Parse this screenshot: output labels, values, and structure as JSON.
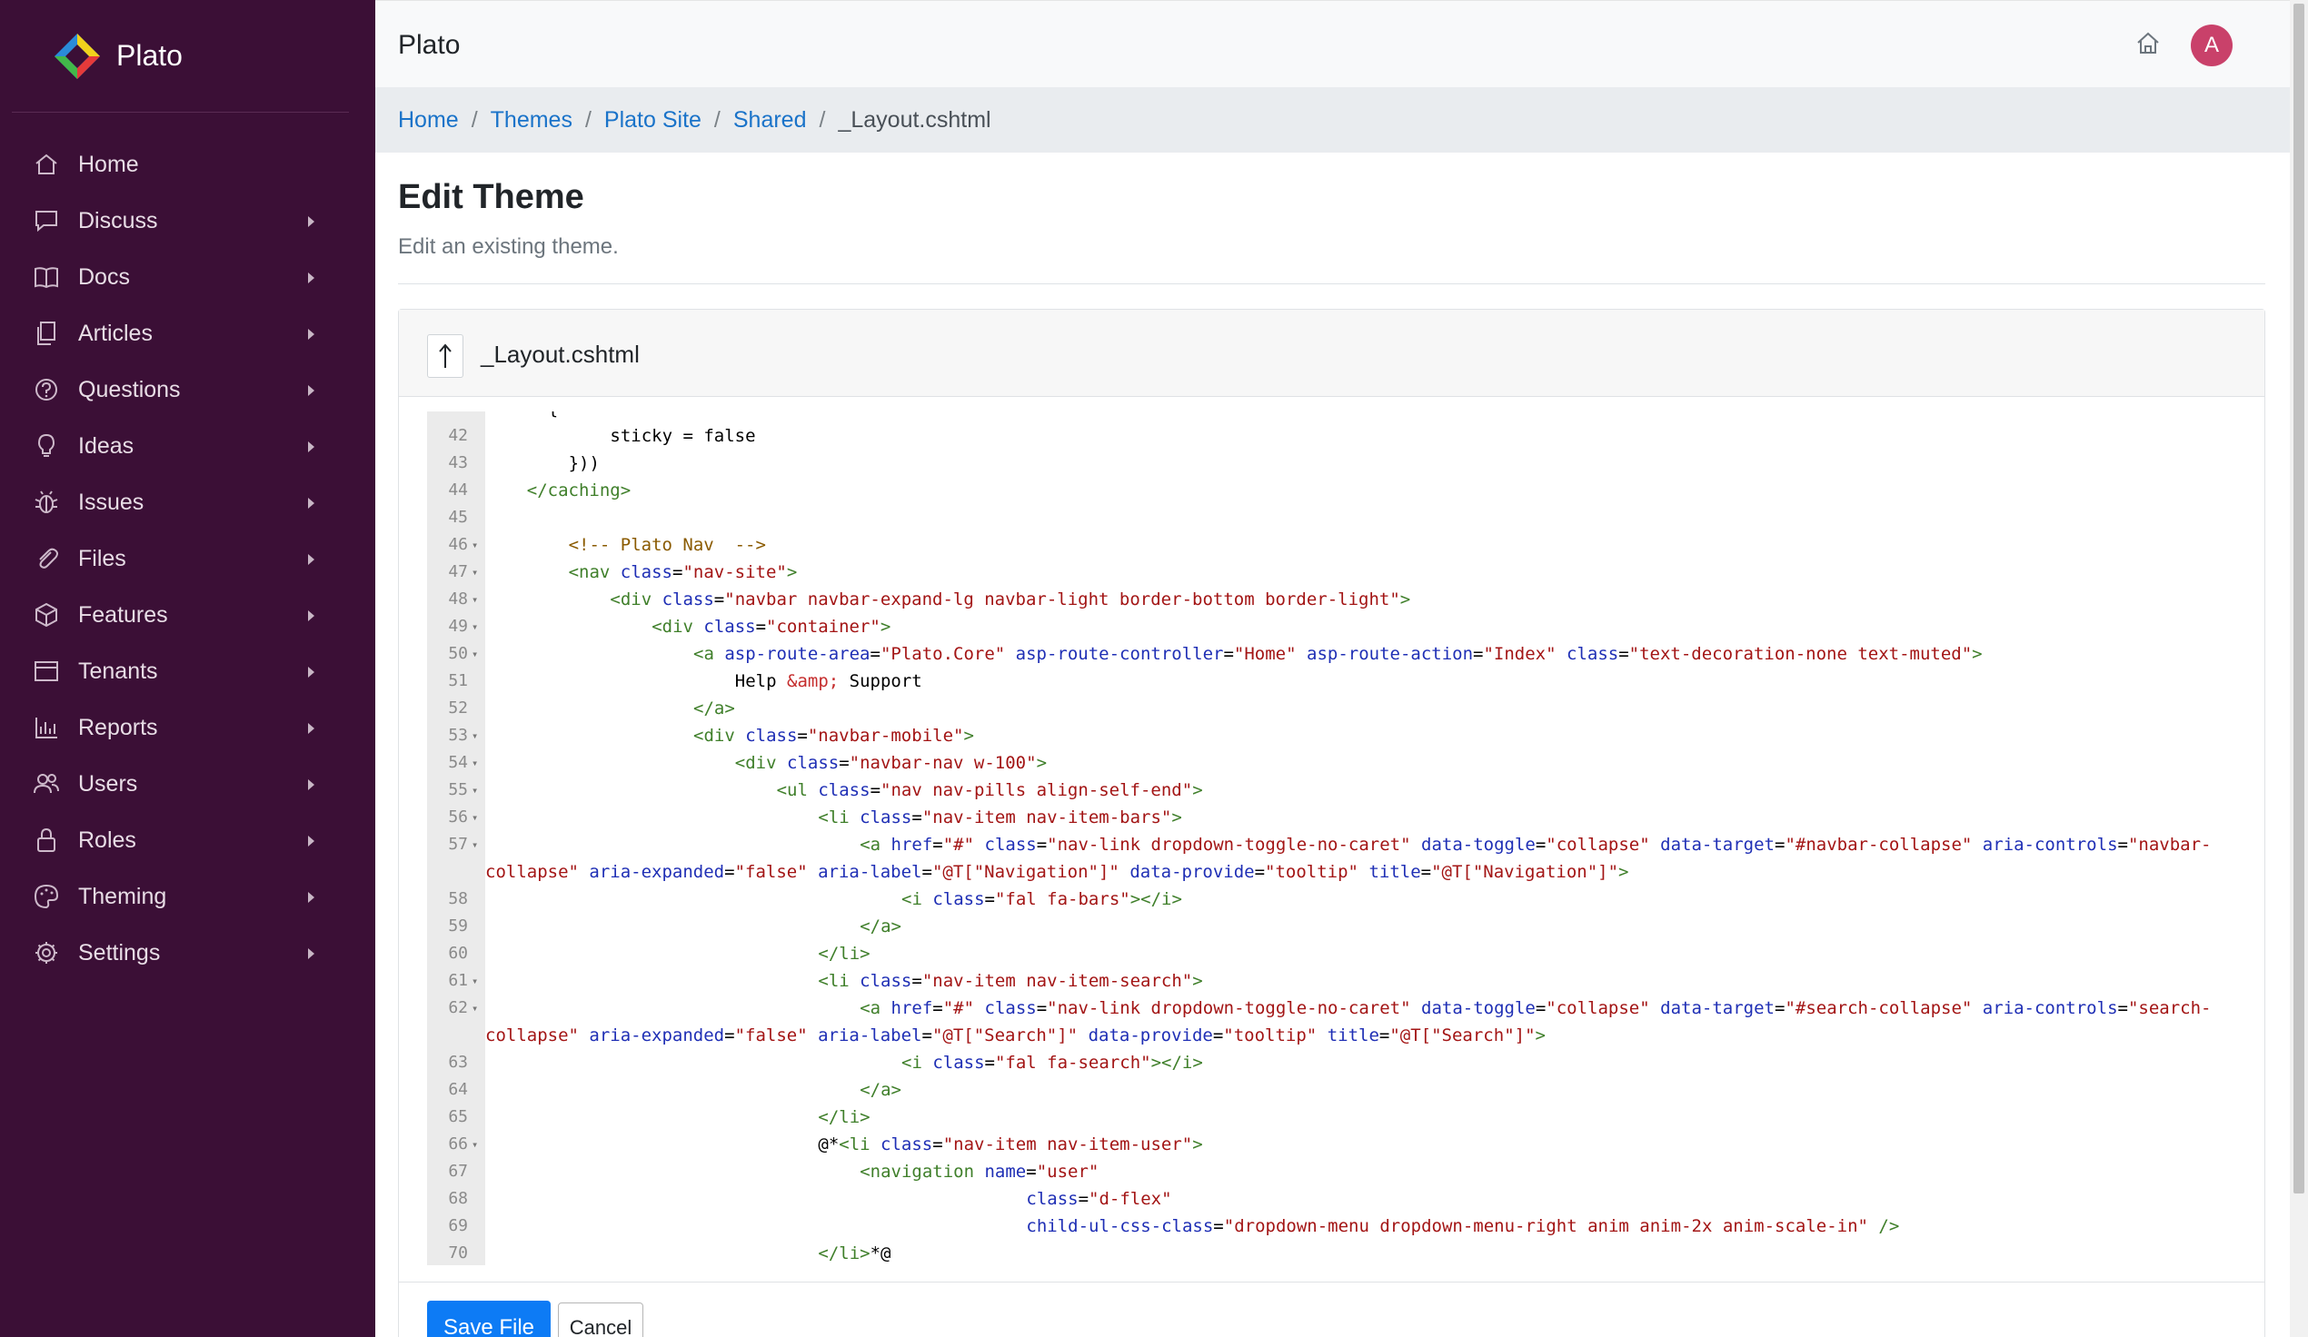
{
  "app": {
    "brand_name": "Plato"
  },
  "sidebar": {
    "items": [
      {
        "label": "Home",
        "icon": "home-icon",
        "has_submenu": false
      },
      {
        "label": "Discuss",
        "icon": "chat-icon",
        "has_submenu": true
      },
      {
        "label": "Docs",
        "icon": "book-icon",
        "has_submenu": true
      },
      {
        "label": "Articles",
        "icon": "copy-icon",
        "has_submenu": true
      },
      {
        "label": "Questions",
        "icon": "question-icon",
        "has_submenu": true
      },
      {
        "label": "Ideas",
        "icon": "lightbulb-icon",
        "has_submenu": true
      },
      {
        "label": "Issues",
        "icon": "bug-icon",
        "has_submenu": true
      },
      {
        "label": "Files",
        "icon": "paperclip-icon",
        "has_submenu": true
      },
      {
        "label": "Features",
        "icon": "cube-icon",
        "has_submenu": true
      },
      {
        "label": "Tenants",
        "icon": "window-icon",
        "has_submenu": true
      },
      {
        "label": "Reports",
        "icon": "bar-chart-icon",
        "has_submenu": true
      },
      {
        "label": "Users",
        "icon": "users-icon",
        "has_submenu": true
      },
      {
        "label": "Roles",
        "icon": "lock-icon",
        "has_submenu": true
      },
      {
        "label": "Theming",
        "icon": "palette-icon",
        "has_submenu": true
      },
      {
        "label": "Settings",
        "icon": "gear-icon",
        "has_submenu": true
      }
    ]
  },
  "header": {
    "title": "Plato",
    "avatar_initial": "A"
  },
  "breadcrumb": {
    "items": [
      "Home",
      "Themes",
      "Plato Site",
      "Shared"
    ],
    "current": "_Layout.cshtml"
  },
  "page": {
    "title": "Edit Theme",
    "subtitle": "Edit an existing theme."
  },
  "editor": {
    "file_name": "_Layout.cshtml",
    "save_label": "Save File",
    "cancel_label": "Cancel"
  },
  "code_lines": [
    {
      "n": "",
      "fold": false,
      "indent": 6,
      "parts": [
        [
          "p",
          "{"
        ]
      ]
    },
    {
      "n": "42",
      "fold": false,
      "indent": 12,
      "parts": [
        [
          "p",
          "sticky = false"
        ]
      ]
    },
    {
      "n": "43",
      "fold": false,
      "indent": 8,
      "parts": [
        [
          "p",
          "}))"
        ]
      ]
    },
    {
      "n": "44",
      "fold": false,
      "indent": 4,
      "parts": [
        [
          "t",
          "</caching>"
        ]
      ]
    },
    {
      "n": "45",
      "fold": false,
      "indent": 0,
      "parts": []
    },
    {
      "n": "46",
      "fold": true,
      "indent": 8,
      "parts": [
        [
          "c",
          "<!-- Plato Nav  -->"
        ]
      ]
    },
    {
      "n": "47",
      "fold": true,
      "indent": 8,
      "parts": [
        [
          "t",
          "<nav "
        ],
        [
          "a",
          "class"
        ],
        [
          "p",
          "="
        ],
        [
          "s",
          "\"nav-site\""
        ],
        [
          "t",
          ">"
        ]
      ]
    },
    {
      "n": "48",
      "fold": true,
      "indent": 12,
      "parts": [
        [
          "t",
          "<div "
        ],
        [
          "a",
          "class"
        ],
        [
          "p",
          "="
        ],
        [
          "s",
          "\"navbar navbar-expand-lg navbar-light border-bottom border-light\""
        ],
        [
          "t",
          ">"
        ]
      ]
    },
    {
      "n": "49",
      "fold": true,
      "indent": 16,
      "parts": [
        [
          "t",
          "<div "
        ],
        [
          "a",
          "class"
        ],
        [
          "p",
          "="
        ],
        [
          "s",
          "\"container\""
        ],
        [
          "t",
          ">"
        ]
      ]
    },
    {
      "n": "50",
      "fold": true,
      "indent": 20,
      "parts": [
        [
          "t",
          "<a "
        ],
        [
          "a",
          "asp-route-area"
        ],
        [
          "p",
          "="
        ],
        [
          "s",
          "\"Plato.Core\""
        ],
        [
          "p",
          " "
        ],
        [
          "a",
          "asp-route-controller"
        ],
        [
          "p",
          "="
        ],
        [
          "s",
          "\"Home\""
        ],
        [
          "p",
          " "
        ],
        [
          "a",
          "asp-route-action"
        ],
        [
          "p",
          "="
        ],
        [
          "s",
          "\"Index\""
        ],
        [
          "p",
          " "
        ],
        [
          "a",
          "class"
        ],
        [
          "p",
          "="
        ],
        [
          "s",
          "\"text-decoration-none text-muted\""
        ],
        [
          "t",
          ">"
        ]
      ]
    },
    {
      "n": "51",
      "fold": false,
      "indent": 24,
      "parts": [
        [
          "p",
          "Help "
        ],
        [
          "e",
          "&amp;"
        ],
        [
          "p",
          " Support"
        ]
      ]
    },
    {
      "n": "52",
      "fold": false,
      "indent": 20,
      "parts": [
        [
          "t",
          "</a>"
        ]
      ]
    },
    {
      "n": "53",
      "fold": true,
      "indent": 20,
      "parts": [
        [
          "t",
          "<div "
        ],
        [
          "a",
          "class"
        ],
        [
          "p",
          "="
        ],
        [
          "s",
          "\"navbar-mobile\""
        ],
        [
          "t",
          ">"
        ]
      ]
    },
    {
      "n": "54",
      "fold": true,
      "indent": 24,
      "parts": [
        [
          "t",
          "<div "
        ],
        [
          "a",
          "class"
        ],
        [
          "p",
          "="
        ],
        [
          "s",
          "\"navbar-nav w-100\""
        ],
        [
          "t",
          ">"
        ]
      ]
    },
    {
      "n": "55",
      "fold": true,
      "indent": 28,
      "parts": [
        [
          "t",
          "<ul "
        ],
        [
          "a",
          "class"
        ],
        [
          "p",
          "="
        ],
        [
          "s",
          "\"nav nav-pills align-self-end\""
        ],
        [
          "t",
          ">"
        ]
      ]
    },
    {
      "n": "56",
      "fold": true,
      "indent": 32,
      "parts": [
        [
          "t",
          "<li "
        ],
        [
          "a",
          "class"
        ],
        [
          "p",
          "="
        ],
        [
          "s",
          "\"nav-item nav-item-bars\""
        ],
        [
          "t",
          ">"
        ]
      ]
    },
    {
      "n": "57",
      "fold": true,
      "indent": 36,
      "parts": [
        [
          "t",
          "<a "
        ],
        [
          "a",
          "href"
        ],
        [
          "p",
          "="
        ],
        [
          "s",
          "\"#\""
        ],
        [
          "p",
          " "
        ],
        [
          "a",
          "class"
        ],
        [
          "p",
          "="
        ],
        [
          "s",
          "\"nav-link dropdown-toggle-no-caret\""
        ],
        [
          "p",
          " "
        ],
        [
          "a",
          "data-toggle"
        ],
        [
          "p",
          "="
        ],
        [
          "s",
          "\"collapse\""
        ],
        [
          "p",
          " "
        ],
        [
          "a",
          "data-target"
        ],
        [
          "p",
          "="
        ],
        [
          "s",
          "\"#navbar-collapse\""
        ],
        [
          "p",
          " "
        ],
        [
          "a",
          "aria-controls"
        ],
        [
          "p",
          "="
        ],
        [
          "s",
          "\"navbar-"
        ]
      ]
    },
    {
      "n": "",
      "fold": false,
      "indent": 0,
      "parts": [
        [
          "s",
          "collapse\""
        ],
        [
          "p",
          " "
        ],
        [
          "a",
          "aria-expanded"
        ],
        [
          "p",
          "="
        ],
        [
          "s",
          "\"false\""
        ],
        [
          "p",
          " "
        ],
        [
          "a",
          "aria-label"
        ],
        [
          "p",
          "="
        ],
        [
          "s",
          "\"@T[\"Navigation\"]\""
        ],
        [
          "p",
          " "
        ],
        [
          "a",
          "data-provide"
        ],
        [
          "p",
          "="
        ],
        [
          "s",
          "\"tooltip\""
        ],
        [
          "p",
          " "
        ],
        [
          "a",
          "title"
        ],
        [
          "p",
          "="
        ],
        [
          "s",
          "\"@T[\"Navigation\"]\""
        ],
        [
          "t",
          ">"
        ]
      ]
    },
    {
      "n": "58",
      "fold": false,
      "indent": 40,
      "parts": [
        [
          "t",
          "<i "
        ],
        [
          "a",
          "class"
        ],
        [
          "p",
          "="
        ],
        [
          "s",
          "\"fal fa-bars\""
        ],
        [
          "t",
          "></i>"
        ]
      ]
    },
    {
      "n": "59",
      "fold": false,
      "indent": 36,
      "parts": [
        [
          "t",
          "</a>"
        ]
      ]
    },
    {
      "n": "60",
      "fold": false,
      "indent": 32,
      "parts": [
        [
          "t",
          "</li>"
        ]
      ]
    },
    {
      "n": "61",
      "fold": true,
      "indent": 32,
      "parts": [
        [
          "t",
          "<li "
        ],
        [
          "a",
          "class"
        ],
        [
          "p",
          "="
        ],
        [
          "s",
          "\"nav-item nav-item-search\""
        ],
        [
          "t",
          ">"
        ]
      ]
    },
    {
      "n": "62",
      "fold": true,
      "indent": 36,
      "parts": [
        [
          "t",
          "<a "
        ],
        [
          "a",
          "href"
        ],
        [
          "p",
          "="
        ],
        [
          "s",
          "\"#\""
        ],
        [
          "p",
          " "
        ],
        [
          "a",
          "class"
        ],
        [
          "p",
          "="
        ],
        [
          "s",
          "\"nav-link dropdown-toggle-no-caret\""
        ],
        [
          "p",
          " "
        ],
        [
          "a",
          "data-toggle"
        ],
        [
          "p",
          "="
        ],
        [
          "s",
          "\"collapse\""
        ],
        [
          "p",
          " "
        ],
        [
          "a",
          "data-target"
        ],
        [
          "p",
          "="
        ],
        [
          "s",
          "\"#search-collapse\""
        ],
        [
          "p",
          " "
        ],
        [
          "a",
          "aria-controls"
        ],
        [
          "p",
          "="
        ],
        [
          "s",
          "\"search-"
        ]
      ]
    },
    {
      "n": "",
      "fold": false,
      "indent": 0,
      "parts": [
        [
          "s",
          "collapse\""
        ],
        [
          "p",
          " "
        ],
        [
          "a",
          "aria-expanded"
        ],
        [
          "p",
          "="
        ],
        [
          "s",
          "\"false\""
        ],
        [
          "p",
          " "
        ],
        [
          "a",
          "aria-label"
        ],
        [
          "p",
          "="
        ],
        [
          "s",
          "\"@T[\"Search\"]\""
        ],
        [
          "p",
          " "
        ],
        [
          "a",
          "data-provide"
        ],
        [
          "p",
          "="
        ],
        [
          "s",
          "\"tooltip\""
        ],
        [
          "p",
          " "
        ],
        [
          "a",
          "title"
        ],
        [
          "p",
          "="
        ],
        [
          "s",
          "\"@T[\"Search\"]\""
        ],
        [
          "t",
          ">"
        ]
      ]
    },
    {
      "n": "63",
      "fold": false,
      "indent": 40,
      "parts": [
        [
          "t",
          "<i "
        ],
        [
          "a",
          "class"
        ],
        [
          "p",
          "="
        ],
        [
          "s",
          "\"fal fa-search\""
        ],
        [
          "t",
          "></i>"
        ]
      ]
    },
    {
      "n": "64",
      "fold": false,
      "indent": 36,
      "parts": [
        [
          "t",
          "</a>"
        ]
      ]
    },
    {
      "n": "65",
      "fold": false,
      "indent": 32,
      "parts": [
        [
          "t",
          "</li>"
        ]
      ]
    },
    {
      "n": "66",
      "fold": true,
      "indent": 32,
      "parts": [
        [
          "p",
          "@*"
        ],
        [
          "t",
          "<li "
        ],
        [
          "a",
          "class"
        ],
        [
          "p",
          "="
        ],
        [
          "s",
          "\"nav-item nav-item-user\""
        ],
        [
          "t",
          ">"
        ]
      ]
    },
    {
      "n": "67",
      "fold": false,
      "indent": 36,
      "parts": [
        [
          "t",
          "<navigation "
        ],
        [
          "a",
          "name"
        ],
        [
          "p",
          "="
        ],
        [
          "s",
          "\"user\""
        ]
      ]
    },
    {
      "n": "68",
      "fold": false,
      "indent": 52,
      "parts": [
        [
          "a",
          "class"
        ],
        [
          "p",
          "="
        ],
        [
          "s",
          "\"d-flex\""
        ]
      ]
    },
    {
      "n": "69",
      "fold": false,
      "indent": 52,
      "parts": [
        [
          "a",
          "child-ul-css-class"
        ],
        [
          "p",
          "="
        ],
        [
          "s",
          "\"dropdown-menu dropdown-menu-right anim anim-2x anim-scale-in\""
        ],
        [
          "p",
          " "
        ],
        [
          "t",
          "/>"
        ]
      ]
    },
    {
      "n": "70",
      "fold": false,
      "indent": 32,
      "parts": [
        [
          "t",
          "</li>"
        ],
        [
          "p",
          "*@"
        ]
      ]
    }
  ]
}
